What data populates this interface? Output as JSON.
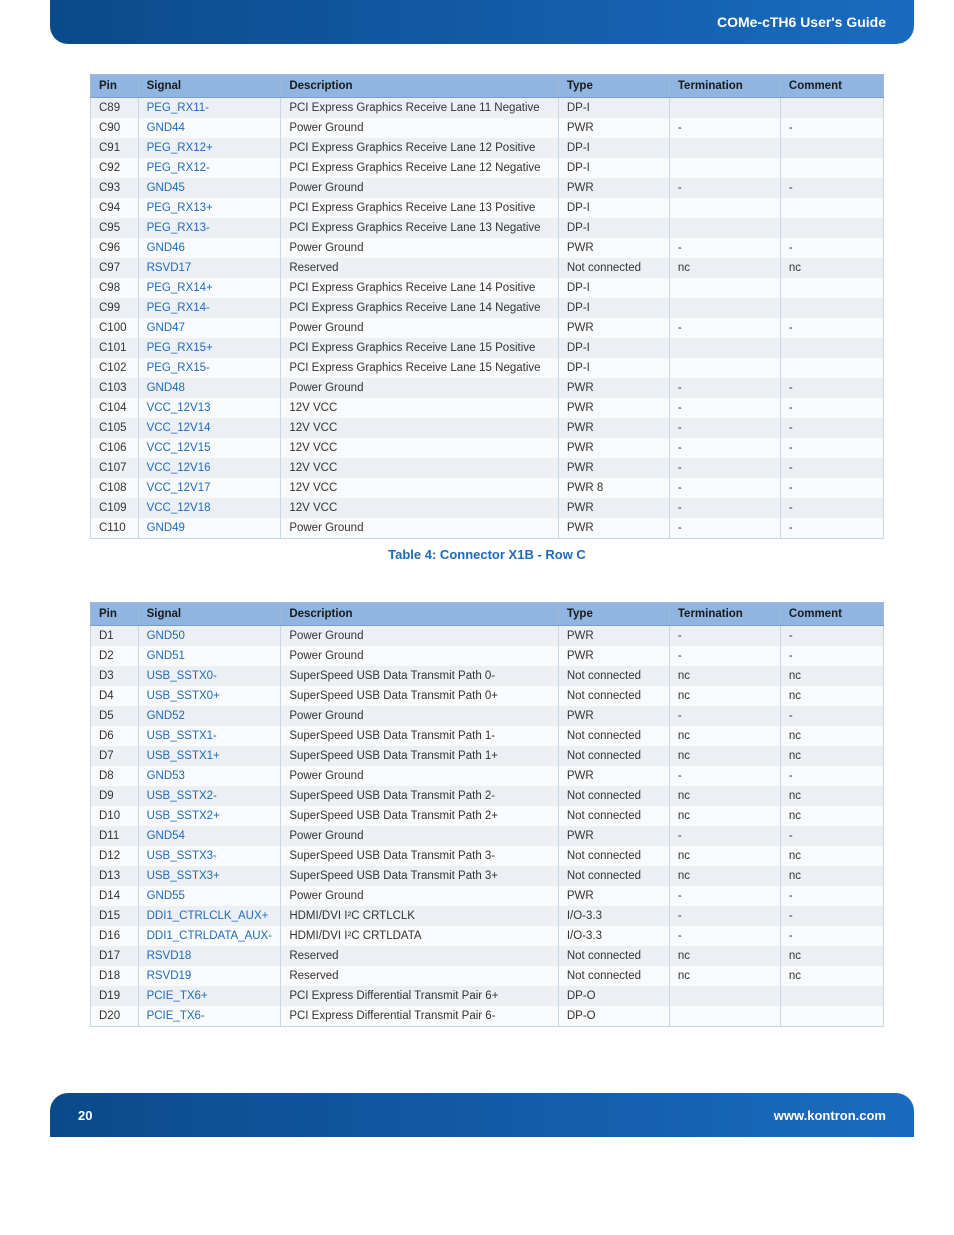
{
  "header": {
    "title": "COMe-cTH6 User's Guide"
  },
  "footer": {
    "page": "20",
    "url": "www.kontron.com"
  },
  "table1": {
    "caption": "Table 4: Connector X1B - Row C",
    "headers": [
      "Pin",
      "Signal",
      "Description",
      "Type",
      "Termination",
      "Comment"
    ],
    "rows": [
      [
        "C89",
        "PEG_RX11-",
        "PCI Express Graphics Receive Lane 11 Negative",
        "DP-I",
        "",
        ""
      ],
      [
        "C90",
        "GND44",
        "Power Ground",
        "PWR",
        "-",
        "-"
      ],
      [
        "C91",
        "PEG_RX12+",
        "PCI Express Graphics Receive Lane 12 Positive",
        "DP-I",
        "",
        ""
      ],
      [
        "C92",
        "PEG_RX12-",
        "PCI Express Graphics Receive Lane 12 Negative",
        "DP-I",
        "",
        ""
      ],
      [
        "C93",
        "GND45",
        "Power Ground",
        "PWR",
        "-",
        "-"
      ],
      [
        "C94",
        "PEG_RX13+",
        "PCI Express Graphics Receive Lane 13 Positive",
        "DP-I",
        "",
        ""
      ],
      [
        "C95",
        "PEG_RX13-",
        "PCI Express Graphics Receive Lane 13 Negative",
        "DP-I",
        "",
        ""
      ],
      [
        "C96",
        "GND46",
        "Power Ground",
        "PWR",
        "-",
        "-"
      ],
      [
        "C97",
        "RSVD17",
        "Reserved",
        "Not connected",
        "nc",
        "nc"
      ],
      [
        "C98",
        "PEG_RX14+",
        "PCI Express Graphics Receive Lane 14 Positive",
        "DP-I",
        "",
        ""
      ],
      [
        "C99",
        "PEG_RX14-",
        "PCI Express Graphics Receive Lane 14 Negative",
        "DP-I",
        "",
        ""
      ],
      [
        "C100",
        "GND47",
        "Power Ground",
        "PWR",
        "-",
        "-"
      ],
      [
        "C101",
        "PEG_RX15+",
        "PCI Express Graphics Receive Lane 15 Positive",
        "DP-I",
        "",
        ""
      ],
      [
        "C102",
        "PEG_RX15-",
        "PCI Express Graphics Receive Lane 15 Negative",
        "DP-I",
        "",
        ""
      ],
      [
        "C103",
        "GND48",
        "Power Ground",
        "PWR",
        "-",
        "-"
      ],
      [
        "C104",
        "VCC_12V13",
        "12V VCC",
        "PWR",
        "-",
        "-"
      ],
      [
        "C105",
        "VCC_12V14",
        "12V VCC",
        "PWR",
        "-",
        "-"
      ],
      [
        "C106",
        "VCC_12V15",
        "12V VCC",
        "PWR",
        "-",
        "-"
      ],
      [
        "C107",
        "VCC_12V16",
        "12V VCC",
        "PWR",
        "-",
        "-"
      ],
      [
        "C108",
        "VCC_12V17",
        "12V VCC",
        "PWR 8",
        "-",
        "-"
      ],
      [
        "C109",
        "VCC_12V18",
        "12V VCC",
        "PWR",
        "-",
        "-"
      ],
      [
        "C110",
        "GND49",
        "Power Ground",
        "PWR",
        "-",
        "-"
      ]
    ]
  },
  "table2": {
    "headers": [
      "Pin",
      "Signal",
      "Description",
      "Type",
      "Termination",
      "Comment"
    ],
    "rows": [
      [
        "D1",
        "GND50",
        "Power Ground",
        "PWR",
        "-",
        "-"
      ],
      [
        "D2",
        "GND51",
        "Power Ground",
        "PWR",
        "-",
        "-"
      ],
      [
        "D3",
        "USB_SSTX0-",
        "SuperSpeed USB Data Transmit Path 0-",
        "Not connected",
        "nc",
        "nc"
      ],
      [
        "D4",
        "USB_SSTX0+",
        "SuperSpeed USB Data Transmit Path 0+",
        "Not connected",
        "nc",
        "nc"
      ],
      [
        "D5",
        "GND52",
        "Power Ground",
        "PWR",
        "-",
        "-"
      ],
      [
        "D6",
        "USB_SSTX1-",
        "SuperSpeed USB Data Transmit Path 1-",
        "Not connected",
        "nc",
        "nc"
      ],
      [
        "D7",
        "USB_SSTX1+",
        "SuperSpeed USB Data Transmit Path 1+",
        "Not connected",
        "nc",
        "nc"
      ],
      [
        "D8",
        "GND53",
        "Power Ground",
        "PWR",
        "-",
        "-"
      ],
      [
        "D9",
        "USB_SSTX2-",
        "SuperSpeed USB Data Transmit Path 2-",
        "Not connected",
        "nc",
        "nc"
      ],
      [
        "D10",
        "USB_SSTX2+",
        "SuperSpeed USB Data Transmit Path 2+",
        "Not connected",
        "nc",
        "nc"
      ],
      [
        "D11",
        "GND54",
        "Power Ground",
        "PWR",
        "-",
        "-"
      ],
      [
        "D12",
        "USB_SSTX3-",
        "SuperSpeed USB Data Transmit Path 3-",
        "Not connected",
        "nc",
        "nc"
      ],
      [
        "D13",
        "USB_SSTX3+",
        "SuperSpeed USB Data Transmit Path 3+",
        "Not connected",
        "nc",
        "nc"
      ],
      [
        "D14",
        "GND55",
        "Power Ground",
        "PWR",
        "-",
        "-"
      ],
      [
        "D15",
        "DDI1_CTRLCLK_AUX+",
        "HDMI/DVI I²C CRTLCLK",
        "I/O-3.3",
        "-",
        "-"
      ],
      [
        "D16",
        "DDI1_CTRLDATA_AUX-",
        "HDMI/DVI I²C CRTLDATA",
        "I/O-3.3",
        "-",
        "-"
      ],
      [
        "D17",
        "RSVD18",
        "Reserved",
        "Not connected",
        "nc",
        "nc"
      ],
      [
        "D18",
        "RSVD19",
        "Reserved",
        "Not connected",
        "nc",
        "nc"
      ],
      [
        "D19",
        "PCIE_TX6+",
        "PCI Express Differential Transmit Pair 6+",
        "DP-O",
        "",
        ""
      ],
      [
        "D20",
        "PCIE_TX6-",
        "PCI Express Differential Transmit Pair 6-",
        "DP-O",
        "",
        ""
      ]
    ]
  }
}
